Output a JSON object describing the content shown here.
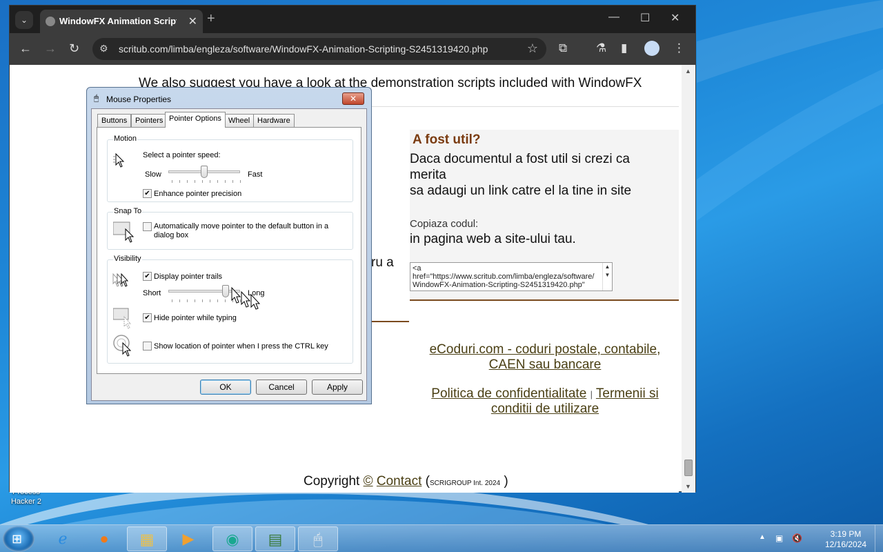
{
  "desktop": {
    "icon_label_line1": "Process",
    "icon_label_line2": "Hacker 2"
  },
  "browser": {
    "tab_title": "WindowFX Animation Scripting",
    "url": "scritub.com/limba/engleza/software/WindowFX-Animation-Scripting-S2451319420.php"
  },
  "page": {
    "intro_text": "We also suggest you have a look at the demonstration scripts included with WindowFX",
    "left_fragment": "ru a",
    "panel": {
      "heading": "A fost util?",
      "line1": "Daca documentul a fost util si crezi ca",
      "line2": "merita",
      "line3": "sa adaugi un link catre el la tine in site",
      "copy_label": "Copiaza codul:",
      "copy_desc": "in pagina web a site-ului tau.",
      "code_line1": "<a",
      "code_line2": "href=\"https://www.scritub.com/limba/engleza/software/",
      "code_line3": "WindowFX-Animation-Scripting-S2451319420.php\""
    },
    "footer": {
      "link1_line1": "eCoduri.com - coduri postale, contabile,",
      "link1_line2": "CAEN sau bancare",
      "privacy": "Politica de confidentialitate",
      "separator": "|",
      "terms_line1": "Termenii si",
      "terms_line2": "conditii de utilizare",
      "copyright": "Copyright",
      "copy_symbol": "©",
      "contact": "Contact",
      "scrigroup_open": "(",
      "scrigroup": "SCRIGROUP Int. 2024",
      "scrigroup_close": ")"
    }
  },
  "dialog": {
    "title": "Mouse Properties",
    "close": "✕",
    "tabs": [
      "Buttons",
      "Pointers",
      "Pointer Options",
      "Wheel",
      "Hardware"
    ],
    "active_tab": "Pointer Options",
    "motion": {
      "group": "Motion",
      "label": "Select a pointer speed:",
      "slow": "Slow",
      "fast": "Fast",
      "speed_level": 0.5,
      "enhance_label": "Enhance pointer precision",
      "enhance_checked": true
    },
    "snap": {
      "group": "Snap To",
      "label_line1": "Automatically move pointer to the default button in a",
      "label_line2": "dialog box",
      "checked": false
    },
    "visibility": {
      "group": "Visibility",
      "trails_label": "Display pointer trails",
      "trails_checked": true,
      "short": "Short",
      "long": "Long",
      "trail_level": 0.8,
      "hide_label": "Hide pointer while typing",
      "hide_checked": true,
      "ctrl_label": "Show location of pointer when I press the CTRL key",
      "ctrl_checked": false
    },
    "buttons": {
      "ok": "OK",
      "cancel": "Cancel",
      "apply": "Apply"
    }
  },
  "taskbar": {
    "time": "3:19 PM",
    "date": "12/16/2024"
  }
}
